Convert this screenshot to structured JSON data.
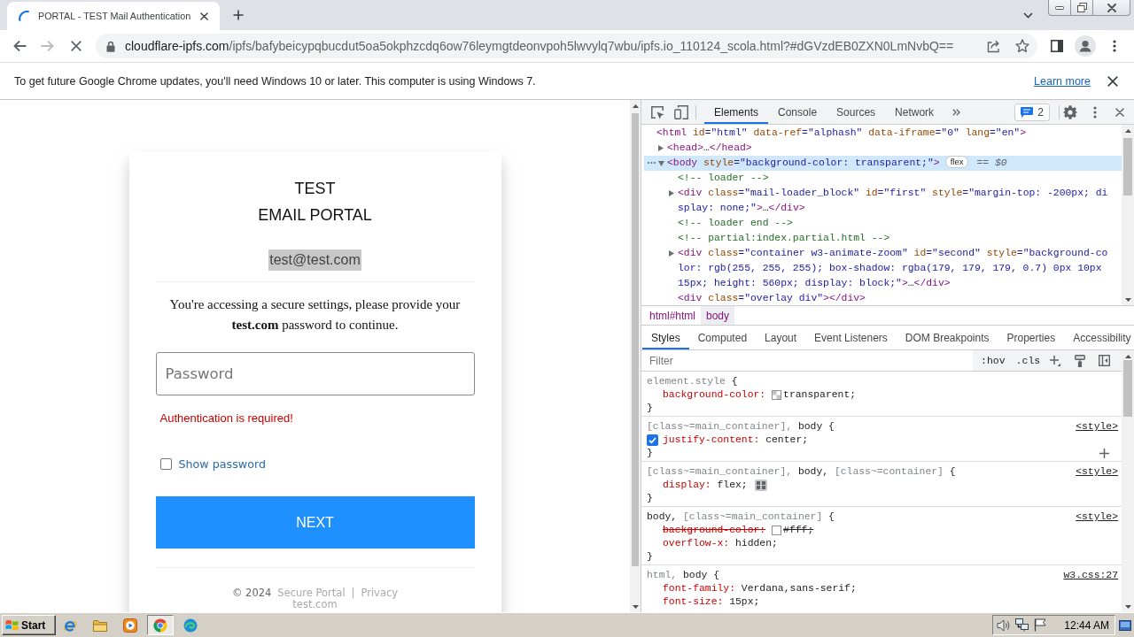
{
  "browser": {
    "tabs": [
      {
        "title": "PORTAL - TEST Mail Authentication",
        "selected": true,
        "loading": true
      }
    ],
    "toolbar": {
      "loading": true,
      "can_go_forward": false,
      "url_host": "cloudflare-ipfs.com",
      "url_path": "/ipfs/bafybeicypqbucdut5oa5okphzcdq6ow76leymgtdeonvpoh5lwvylq7wbu/ipfs.io_110124_scola.html?#dGVzdEB0ZXN0LmNvbQ=="
    },
    "infobar": {
      "message": "To get future Google Chrome updates, you'll need Windows 10 or later. This computer is using Windows 7.",
      "link": "Learn more"
    }
  },
  "page": {
    "title_lines": [
      "TEST",
      "EMAIL PORTAL"
    ],
    "email": {
      "text": "test@test.com",
      "highlighted": true
    },
    "message": "You're accessing a secure settings, please provide your **test.com** password to continue.",
    "password_field": {
      "placeholder": "Password"
    },
    "error": "Authentication is required!",
    "show_password": {
      "label": "Show password",
      "checked": false
    },
    "submit_button": "NEXT",
    "footer": {
      "copyright": "© 2024",
      "links": [
        "Secure Portal",
        "Privacy"
      ],
      "separator": "|",
      "domain": "test.com"
    }
  },
  "devtools": {
    "tabs": [
      {
        "label": "Elements",
        "selected": true
      },
      {
        "label": "Console",
        "selected": false
      },
      {
        "label": "Sources",
        "selected": false
      },
      {
        "label": "Network",
        "selected": false
      }
    ],
    "issues_count": "2",
    "dom_tree": [
      {
        "selected": false,
        "tokens": [
          {
            "kind": "tag",
            "text": "<html"
          },
          {
            "kind": "attr",
            "text": " id"
          },
          {
            "kind": "value",
            "text": "=\"html\""
          },
          {
            "kind": "attr",
            "text": " data-ref"
          },
          {
            "kind": "value",
            "text": "=\"alphash\""
          },
          {
            "kind": "attr",
            "text": " data-iframe"
          },
          {
            "kind": "value",
            "text": "=\"0\""
          },
          {
            "kind": "attr",
            "text": " lang"
          },
          {
            "kind": "value",
            "text": "=\"en\""
          },
          {
            "kind": "tag",
            "text": ">"
          }
        ],
        "children": [
          {
            "expanded": false,
            "selected": false,
            "tokens": [
              {
                "kind": "tag",
                "text": "<head>"
              },
              {
                "kind": "plain",
                "text": "…"
              },
              {
                "kind": "tag",
                "text": "</head>"
              }
            ]
          },
          {
            "expanded": true,
            "selected": true,
            "tokens": [
              {
                "kind": "tag",
                "text": "<body"
              },
              {
                "kind": "attr",
                "text": " style"
              },
              {
                "kind": "value",
                "text": "=\"background-color: transparent;\""
              },
              {
                "kind": "tag",
                "text": ">"
              }
            ],
            "badge": "flex",
            "note": "== *$0*",
            "children": [
              {
                "selected": false,
                "tokens": [
                  {
                    "kind": "comment",
                    "text": "<!-- loader -->"
                  }
                ]
              },
              {
                "expanded": false,
                "selected": false,
                "tokens": [
                  {
                    "kind": "tag",
                    "text": "<div"
                  },
                  {
                    "kind": "attr",
                    "text": " class"
                  },
                  {
                    "kind": "value",
                    "text": "=\"mail-loader_block\""
                  },
                  {
                    "kind": "attr",
                    "text": " id"
                  },
                  {
                    "kind": "value",
                    "text": "=\"first\""
                  },
                  {
                    "kind": "attr",
                    "text": " style"
                  },
                  {
                    "kind": "value",
                    "text": "=\"margin-top: -200px; display: none;\""
                  },
                  {
                    "kind": "tag",
                    "text": ">"
                  },
                  {
                    "kind": "plain",
                    "text": "…"
                  },
                  {
                    "kind": "tag",
                    "text": "</div>"
                  }
                ]
              },
              {
                "selected": false,
                "tokens": [
                  {
                    "kind": "comment",
                    "text": "<!-- loader end -->"
                  }
                ]
              },
              {
                "selected": false,
                "tokens": [
                  {
                    "kind": "comment",
                    "text": "<!-- partial:index.partial.html -->"
                  }
                ]
              },
              {
                "expanded": false,
                "selected": false,
                "tokens": [
                  {
                    "kind": "tag",
                    "text": "<div"
                  },
                  {
                    "kind": "attr",
                    "text": " class"
                  },
                  {
                    "kind": "value",
                    "text": "=\"container w3-animate-zoom\""
                  },
                  {
                    "kind": "attr",
                    "text": " id"
                  },
                  {
                    "kind": "value",
                    "text": "=\"second\""
                  },
                  {
                    "kind": "attr",
                    "text": " style"
                  },
                  {
                    "kind": "value",
                    "text": "=\"background-color: rgb(255, 255, 255); box-shadow: rgba(179, 179, 179, 0.7) 0px 10px 15px; height: 560px; display: block;\""
                  },
                  {
                    "kind": "tag",
                    "text": ">"
                  },
                  {
                    "kind": "plain",
                    "text": "…"
                  },
                  {
                    "kind": "tag",
                    "text": "</div>"
                  }
                ]
              },
              {
                "selected": false,
                "tokens": [
                  {
                    "kind": "tag",
                    "text": "<div"
                  },
                  {
                    "kind": "attr",
                    "text": " class"
                  },
                  {
                    "kind": "value",
                    "text": "=\"overlay div\""
                  },
                  {
                    "kind": "tag",
                    "text": "></div>"
                  }
                ]
              }
            ]
          }
        ]
      }
    ],
    "breadcrumbs": [
      {
        "label": "html#html",
        "selected": false
      },
      {
        "label": "body",
        "selected": true
      }
    ],
    "sidebar_tabs": [
      {
        "label": "Styles",
        "selected": true
      },
      {
        "label": "Computed",
        "selected": false
      },
      {
        "label": "Layout",
        "selected": false
      },
      {
        "label": "Event Listeners",
        "selected": false
      },
      {
        "label": "DOM Breakpoints",
        "selected": false
      },
      {
        "label": "Properties",
        "selected": false
      },
      {
        "label": "Accessibility",
        "selected": false
      }
    ],
    "filter": {
      "placeholder": "Filter",
      "toggles": [
        ":hov",
        ".cls"
      ]
    },
    "rules": [
      {
        "selectors": [
          {
            "text": "element.style",
            "dimmed": true
          }
        ],
        "open": "{",
        "properties": [
          {
            "name": "background-color:",
            "value": "transparent;",
            "swatch": true,
            "checkered": true,
            "checked": false,
            "overridden": false
          }
        ],
        "close": "}",
        "show_add": false
      },
      {
        "selectors": [
          {
            "text": "[class~=main_container],",
            "dimmed": true
          },
          {
            "text": "body",
            "dimmed": false
          }
        ],
        "open": "{",
        "source": "<style>",
        "properties": [
          {
            "name": "justify-content:",
            "value": "center;",
            "checked": true,
            "overridden": false
          }
        ],
        "close": "}",
        "show_add": true
      },
      {
        "selectors": [
          {
            "text": "[class~=main_container],",
            "dimmed": true
          },
          {
            "text": "body,",
            "dimmed": false
          },
          {
            "text": "[class~=container]",
            "dimmed": true
          }
        ],
        "open": "{",
        "source": "<style>",
        "properties": [
          {
            "name": "display:",
            "value": "flex;",
            "checked": false,
            "overridden": false,
            "flex_editor": true
          }
        ],
        "close": "}",
        "show_add": false
      },
      {
        "selectors": [
          {
            "text": "body,",
            "dimmed": false
          },
          {
            "text": "[class~=main_container]",
            "dimmed": true
          }
        ],
        "open": "{",
        "source": "<style>",
        "properties": [
          {
            "name": "background-color:",
            "value": "#fff;",
            "swatch": true,
            "checkered": false,
            "checked": false,
            "overridden": true
          },
          {
            "name": "overflow-x:",
            "value": "hidden;",
            "checked": false,
            "overridden": false
          }
        ],
        "close": "}",
        "show_add": false
      },
      {
        "selectors": [
          {
            "text": "html,",
            "dimmed": true
          },
          {
            "text": "body",
            "dimmed": false
          }
        ],
        "open": "{",
        "source": "w3.css:27",
        "properties": [
          {
            "name": "font-family:",
            "value": "Verdana,sans-serif;",
            "checked": false,
            "overridden": false
          },
          {
            "name": "font-size:",
            "value": "15px;",
            "checked": false,
            "overridden": false
          }
        ],
        "show_add": false
      }
    ]
  },
  "taskbar": {
    "start": "Start",
    "apps": [
      {
        "kind": "ie",
        "selected": false
      },
      {
        "kind": "explorer",
        "selected": false
      },
      {
        "kind": "media",
        "selected": false
      },
      {
        "kind": "chrome",
        "selected": true
      },
      {
        "kind": "edge",
        "selected": false
      }
    ],
    "tray": [
      {
        "kind": "volume"
      },
      {
        "kind": "network"
      },
      {
        "kind": "flag"
      }
    ],
    "clock": "12:44 AM"
  }
}
